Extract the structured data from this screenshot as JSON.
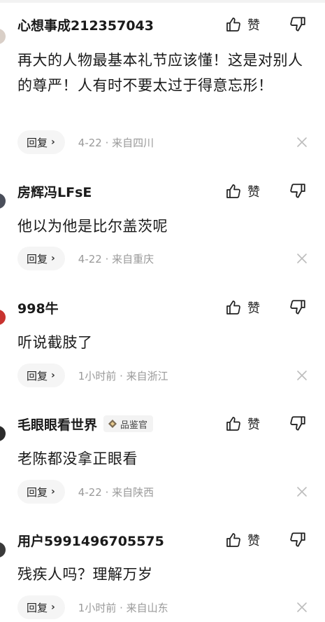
{
  "labels": {
    "like": "赞",
    "reply": "回复"
  },
  "comments": [
    {
      "username": "心想事成212357043",
      "badge": "",
      "content": "再大的人物最基本礼节应该懂！这是对别人的尊严！人有时不要太过于得意忘形！",
      "meta": "4-22 · 来自四川"
    },
    {
      "username": "房辉冯LFsE",
      "badge": "",
      "content": "他以为他是比尔盖茨呢",
      "meta": "4-22 · 来自重庆"
    },
    {
      "username": "998牛",
      "badge": "",
      "content": "听说截肢了",
      "meta": "1小时前 · 来自浙江"
    },
    {
      "username": "毛眼眼看世界",
      "badge": "品鉴官",
      "content": "老陈都没拿正眼看",
      "meta": "4-22 · 来自陕西"
    },
    {
      "username": "用户5991496705575",
      "badge": "",
      "content": "残疾人吗？理解万岁",
      "meta": "1小时前 · 来自山东"
    }
  ],
  "colors": {
    "text": "#1a1a1a",
    "meta": "#9a9a9a",
    "reply_bg": "#f5f5f5",
    "badge_bg": "#f3f3f3",
    "badge_accent": "#c9a36a"
  },
  "icons": {
    "like": "thumbs-up-icon",
    "dislike": "thumbs-down-icon",
    "close": "close-icon",
    "badge": "diamond-badge-icon"
  }
}
